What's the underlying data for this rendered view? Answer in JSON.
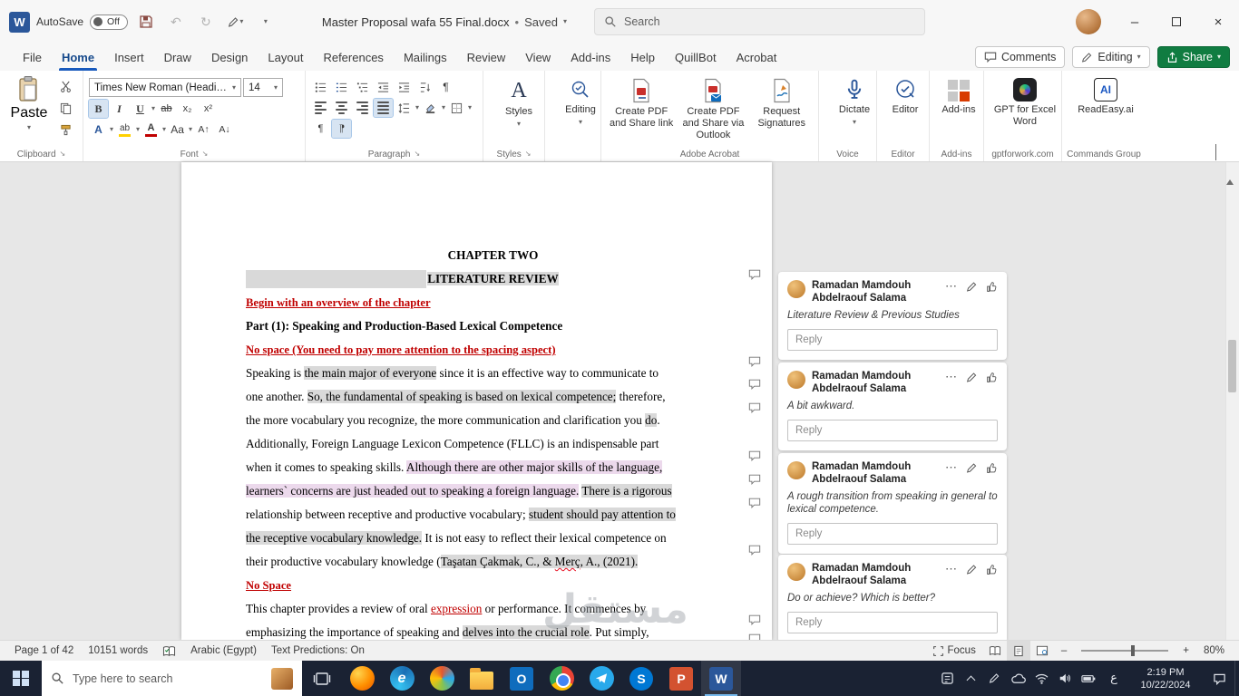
{
  "icons": {
    "chevron_down": "▾",
    "undo": "↶",
    "redo": "↻",
    "ellipsis": "⋯",
    "launcher": "↘",
    "pilcrow": "¶",
    "minimize": "–",
    "close": "×",
    "dot": "•",
    "bold": "B",
    "italic": "I",
    "underline": "U",
    "strikethrough": "ab",
    "subscript": "x₂",
    "superscript": "x²",
    "text_effects": "A",
    "font_color": "A",
    "highlight_ab": "ab",
    "change_case": "Aa",
    "grow_font": "A↑",
    "shrink_font": "A↓",
    "styles_letter": "A",
    "zoom_out": "–",
    "zoom_in": "+",
    "ai_letters": "AI",
    "edge_letter": "e",
    "outlook_letter": "O",
    "skype_letter": "S",
    "ppt_letter": "P",
    "word_letter": "W"
  },
  "titlebar": {
    "autosave": "AutoSave",
    "autosave_state": "Off",
    "title": "Master Proposal wafa 55 Final.docx",
    "saved": "Saved",
    "search_placeholder": "Search"
  },
  "tabs": {
    "file": "File",
    "home": "Home",
    "insert": "Insert",
    "draw": "Draw",
    "design": "Design",
    "layout": "Layout",
    "references": "References",
    "mailings": "Mailings",
    "review": "Review",
    "view": "View",
    "addins": "Add-ins",
    "help": "Help",
    "quillbot": "QuillBot",
    "acrobat": "Acrobat",
    "comments": "Comments",
    "editing_mode": "Editing",
    "share": "Share"
  },
  "ribbon": {
    "paste": "Paste",
    "clipboard_group": "Clipboard",
    "font_name": "Times New Roman (Headings)",
    "font_size": "14",
    "font_group": "Font",
    "paragraph_group": "Paragraph",
    "styles": "Styles",
    "styles_group": "Styles",
    "editing": "Editing",
    "create_pdf_link": "Create PDF and Share link",
    "create_pdf_outlook": "Create PDF and Share via Outlook",
    "request_signatures": "Request Signatures",
    "acrobat_group": "Adobe Acrobat",
    "dictate": "Dictate",
    "voice_group": "Voice",
    "editor": "Editor",
    "editor_group": "Editor",
    "addins": "Add-ins",
    "addins_group": "Add-ins",
    "gpt": "GPT for Excel Word",
    "gpt_group": "gptforwork.com",
    "readeasy": "ReadEasy.ai",
    "readeasy_group": "Commands Group"
  },
  "doc": {
    "chapter": "CHAPTER TWO",
    "title": "LITERATURE REVIEW",
    "note1": "Begin with an overview of the chapter",
    "part": "Part (1): Speaking and Production-Based Lexical Competence",
    "note2": "No space (You need to pay more attention to the spacing aspect)",
    "p1l1a": " Speaking is ",
    "p1l1b": "the main major of everyone",
    "p1l1c": " since it is an effective way to communicate to",
    "p1l2a": "one another. ",
    "p1l2b": "So, the fundamental of speaking is based on lexical competence;",
    "p1l2c": " therefore,",
    "p1l3a": "the more vocabulary you recognize, the more communication and clarification you ",
    "p1l3b": "do",
    "p1l3c": ".",
    "p1l4": "Additionally, Foreign Language Lexicon Competence (FLLC) is an indispensable part",
    "p1l5a": "when it comes to speaking skills. ",
    "p1l5b": "Although there are other major skills of the language,",
    "p1l6a": "learners` concerns are just headed out to speaking a foreign language.",
    "p1l6b": " ",
    "p1l6c": "There is a rigorous",
    "p1l7a": "relationship between receptive and productive vocabulary; ",
    "p1l7b": "student should pay attention to",
    "p1l8a": "the receptive vocabulary knowledge.",
    "p1l8b": " It is not easy to reflect their lexical competence on",
    "p1l9a": "their productive vocabulary knowledge (",
    "p1l9b": "Taşatan Çakmak, C., & ",
    "p1l9c": "Merç",
    "p1l9d": ", A., (2021).",
    "note3": "No Space",
    "p2l1a": "This chapter provides a review of oral ",
    "p2l1b": "expression",
    "p2l1c": " or performance. It commences by",
    "p2l2a": "emphasizing the importance of speaking and ",
    "p2l2b": "delves into the crucial role",
    "p2l2c": ". Put simply,"
  },
  "comments": {
    "author": "Ramadan Mamdouh Abdelraouf Salama",
    "reply_placeholder": "Reply",
    "c1": "Literature Review & Previous Studies",
    "c2": "A bit awkward.",
    "c3": "A rough transition from speaking in general to lexical competence.",
    "c4": "Do or achieve? Which is better?"
  },
  "statusbar": {
    "page": "Page 1 of 42",
    "words": "10151 words",
    "language": "Arabic (Egypt)",
    "predictions": "Text Predictions: On",
    "focus": "Focus",
    "zoom": "80%"
  },
  "taskbar": {
    "search_placeholder": "Type here to search",
    "lang": "ع",
    "time": "2:19 PM",
    "date": "10/22/2024"
  },
  "watermark": "مستقل",
  "colors": {
    "accent_blue": "#185abd",
    "word_blue": "#2b579a",
    "share_green": "#107c41",
    "note_red": "#c00000",
    "selection_gray": "#d9d9d9",
    "selection_pink": "#ecd9ec",
    "taskbar_bg": "#1a2233"
  }
}
